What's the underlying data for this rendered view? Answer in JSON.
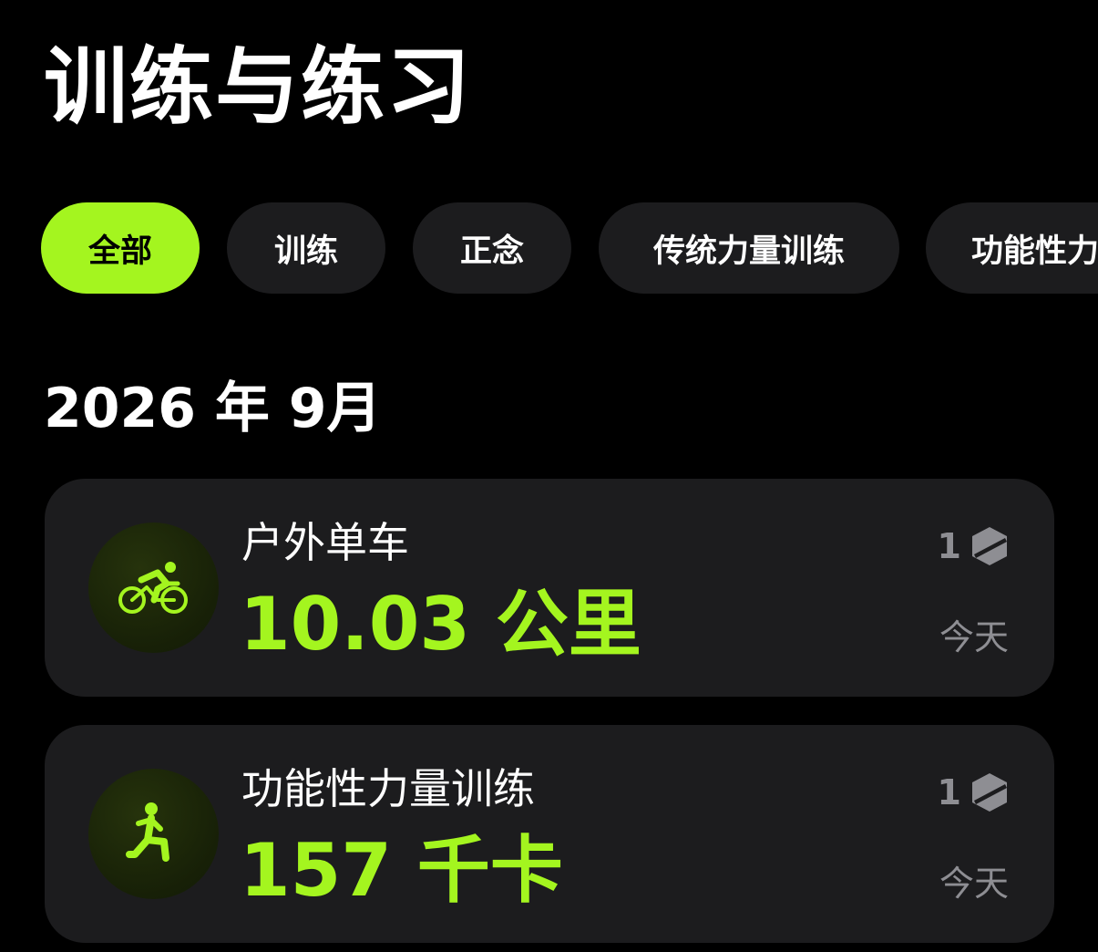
{
  "header": {
    "title": "训练与练习"
  },
  "filters": {
    "chips": [
      {
        "label": "全部",
        "active": true
      },
      {
        "label": "训练",
        "active": false
      },
      {
        "label": "正念",
        "active": false
      },
      {
        "label": "传统力量训练",
        "active": false
      },
      {
        "label": "功能性力量训练",
        "active": false
      }
    ]
  },
  "section": {
    "heading": "2026 年 9月"
  },
  "workouts": [
    {
      "title": "户外单车",
      "value": "10.03 公里",
      "count": "1",
      "date": "今天",
      "icon": "cycling-icon"
    },
    {
      "title": "功能性力量训练",
      "value": "157 千卡",
      "count": "1",
      "date": "今天",
      "icon": "strength-training-icon"
    }
  ],
  "colors": {
    "background": "#000000",
    "card": "#1c1c1e",
    "accent": "#a4f51f",
    "secondary_text": "#8e8e93"
  }
}
